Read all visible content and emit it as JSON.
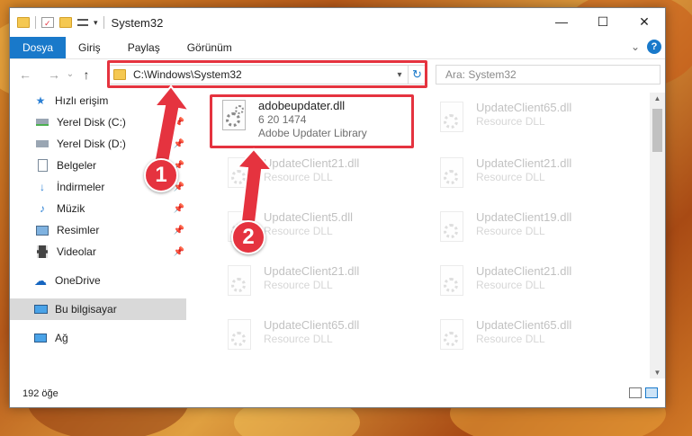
{
  "window": {
    "title": "System32",
    "controls": {
      "minimize": "—",
      "maximize": "☐",
      "close": "✕"
    }
  },
  "ribbon": {
    "tabs": [
      "Dosya",
      "Giriş",
      "Paylaş",
      "Görünüm"
    ],
    "expand": "⌄",
    "help": "?"
  },
  "navigation": {
    "back": "←",
    "forward": "→",
    "recent": "⌄",
    "up": "↑",
    "address": "C:\\Windows\\System32",
    "address_dropdown": "▾",
    "refresh": "↻",
    "search_placeholder": "Ara: System32"
  },
  "sidebar": {
    "items": [
      {
        "label": "Hızlı erişim",
        "icon": "star-icon",
        "pinned": false
      },
      {
        "label": "Yerel Disk (C:)",
        "icon": "drive-icon",
        "pinned": true
      },
      {
        "label": "Yerel Disk (D:)",
        "icon": "drive-icon",
        "pinned": true
      },
      {
        "label": "Belgeler",
        "icon": "documents-icon",
        "pinned": true
      },
      {
        "label": "İndirmeler",
        "icon": "download-icon",
        "pinned": true
      },
      {
        "label": "Müzik",
        "icon": "music-icon",
        "pinned": true
      },
      {
        "label": "Resimler",
        "icon": "pictures-icon",
        "pinned": true
      },
      {
        "label": "Videolar",
        "icon": "videos-icon",
        "pinned": true
      },
      {
        "label": "OneDrive",
        "icon": "cloud-icon",
        "pinned": false
      },
      {
        "label": "Bu bilgisayar",
        "icon": "computer-icon",
        "pinned": false,
        "selected": true
      },
      {
        "label": "Ağ",
        "icon": "network-icon",
        "pinned": false
      }
    ]
  },
  "files": [
    {
      "name": "adobeupdater.dll",
      "line1": "6 20 1474",
      "line2": "Adobe Updater Library",
      "highlighted": true
    },
    {
      "name": "UpdateClient65.dll",
      "line1": "Resource DLL",
      "faded": true
    },
    {
      "name": "UpdateClient21.dll",
      "line1": "Resource DLL",
      "faded": true
    },
    {
      "name": "UpdateClient21.dll",
      "line1": "Resource DLL",
      "faded": true
    },
    {
      "name": "UpdateClient5.dll",
      "line1": "Resource DLL",
      "faded": true
    },
    {
      "name": "UpdateClient19.dll",
      "line1": "Resource DLL",
      "faded": true
    },
    {
      "name": "UpdateClient21.dll",
      "line1": "Resource DLL",
      "faded": true
    },
    {
      "name": "UpdateClient21.dll",
      "line1": "Resource DLL",
      "faded": true
    },
    {
      "name": "UpdateClient65.dll",
      "line1": "Resource DLL",
      "faded": true
    },
    {
      "name": "UpdateClient65.dll",
      "line1": "Resource DLL",
      "faded": true
    }
  ],
  "status": {
    "item_count": "192 öğe"
  },
  "callouts": [
    "1",
    "2"
  ],
  "colors": {
    "accent": "#1979ca",
    "highlight": "#e5333f"
  }
}
